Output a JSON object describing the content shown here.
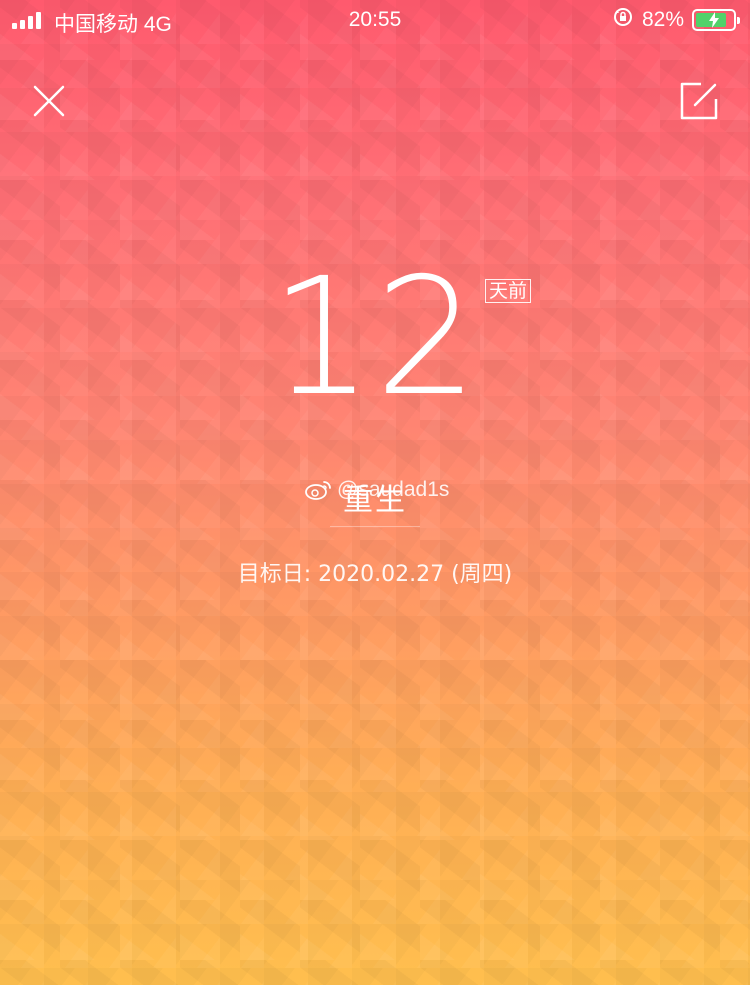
{
  "status_bar": {
    "carrier": "中国移动 4G",
    "time": "20:55",
    "battery_percent": "82%",
    "battery_level": 0.82,
    "icons": [
      "signal-icon",
      "orientation-lock-icon",
      "battery-charging-icon"
    ]
  },
  "header": {
    "close_icon": "close-icon",
    "edit_icon": "edit-icon"
  },
  "countdown": {
    "days": "12",
    "unit": "天前",
    "title": "重生",
    "target_date": "目标日: 2020.02.27 (周四)"
  },
  "watermark": {
    "icon": "weibo-icon",
    "handle": "@saudad1s"
  },
  "colors": {
    "gradient_top": "#ff5a6e",
    "gradient_bottom": "#ffbf4e",
    "battery_fill": "#52d16a"
  }
}
